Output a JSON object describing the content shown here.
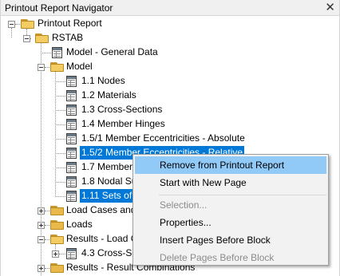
{
  "window": {
    "title": "Printout Report Navigator",
    "close_glyph": "✕"
  },
  "tree": {
    "root": "Printout Report",
    "rstab": "RSTAB",
    "model_general": "Model - General Data",
    "model": "Model",
    "nodes": "1.1 Nodes",
    "materials": "1.2 Materials",
    "cross_sections": "1.3 Cross-Sections",
    "member_hinges": "1.4 Member Hinges",
    "ecc_absolute": "1.5/1 Member Eccentricities - Absolute",
    "ecc_relative": "1.5/2 Member Eccentricities - Relative",
    "item_17": "1.7 Member",
    "item_18": "1.8 Nodal Su",
    "item_111": "1.11 Sets of I",
    "load_cases": "Load Cases and",
    "loads": "Loads",
    "results_load": "Results - Load C",
    "cross_sec_43": "4.3 Cross-Se",
    "results_comb": "Results - Result Combinations"
  },
  "context_menu": {
    "remove": "Remove from Printout Report",
    "start_new_page": "Start with New Page",
    "selection": "Selection...",
    "properties": "Properties...",
    "insert_pages": "Insert Pages Before Block",
    "delete_pages": "Delete Pages Before Block"
  },
  "colors": {
    "selection": "#0078d7",
    "menu_highlight": "#91c9f7",
    "folder": "#e9b949"
  },
  "icons": [
    "folder-icon",
    "document-icon",
    "expand-icon",
    "collapse-icon",
    "close-icon"
  ]
}
